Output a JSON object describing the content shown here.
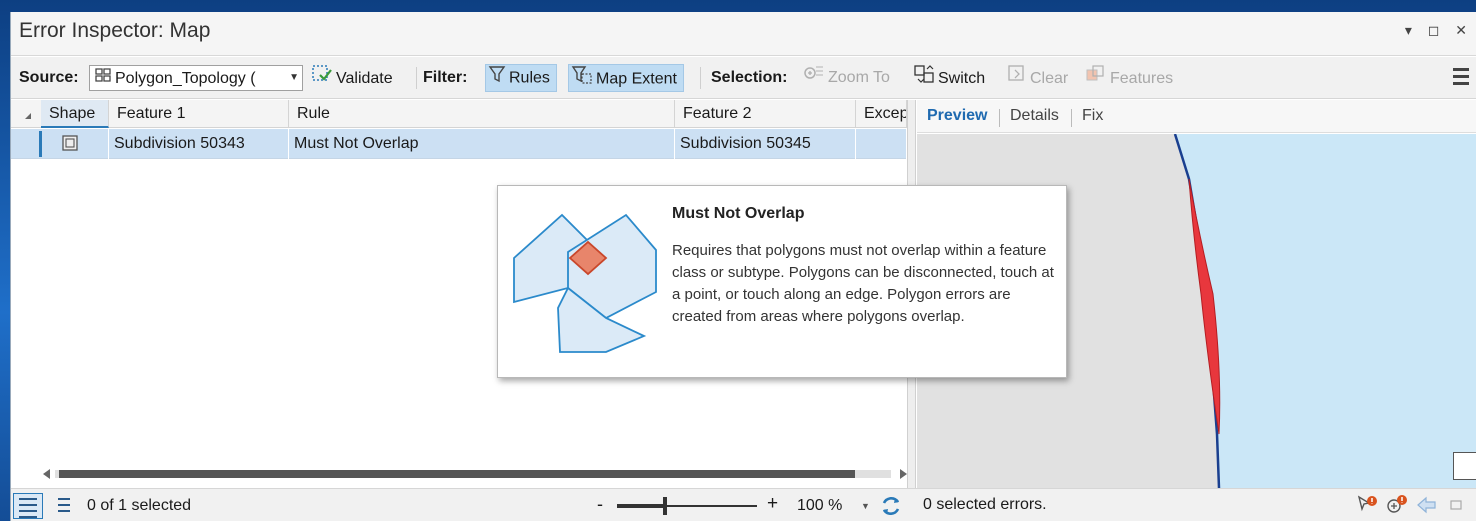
{
  "window": {
    "title": "Error Inspector: Map",
    "controls": "▾ ◻ ✕"
  },
  "toolbar": {
    "source_label": "Source:",
    "source_value": "Polygon_Topology (",
    "validate_label": "Validate",
    "filter_label": "Filter:",
    "rules_label": "Rules",
    "map_extent_label": "Map Extent",
    "selection_label": "Selection:",
    "zoom_to_label": "Zoom To",
    "switch_label": "Switch",
    "clear_label": "Clear",
    "features_label": "Features"
  },
  "table": {
    "columns": [
      "Shape",
      "Feature 1",
      "Rule",
      "Feature 2",
      "Excep"
    ],
    "rows": [
      {
        "shape": "polygon-icon",
        "feature1": "Subdivision 50343",
        "rule": "Must Not Overlap",
        "feature2": "Subdivision 50345",
        "exception": ""
      }
    ]
  },
  "status": {
    "selected_count": "0 of 1 selected",
    "zoom_minus": "-",
    "zoom_plus": "+",
    "zoom_level": "100 %",
    "zoom_level_value": 60
  },
  "right_panel": {
    "tabs": [
      {
        "label": "Preview",
        "active": true
      },
      {
        "label": "Details",
        "active": false
      },
      {
        "label": "Fix",
        "active": false
      }
    ],
    "status_text": "0 selected errors."
  },
  "tooltip": {
    "title": "Must Not Overlap",
    "body": "Requires that polygons must not overlap within a feature class or subtype. Polygons can be disconnected, touch at a point, or touch along an edge. Polygon errors are created from areas where polygons overlap."
  },
  "colors": {
    "accent": "#1f6ab0",
    "selected_row": "#cce0f3",
    "active_button": "#bfdcf3",
    "map_background": "#e1e1e1",
    "map_feature": "#cbe7f7",
    "error_fill": "#e8373d"
  }
}
